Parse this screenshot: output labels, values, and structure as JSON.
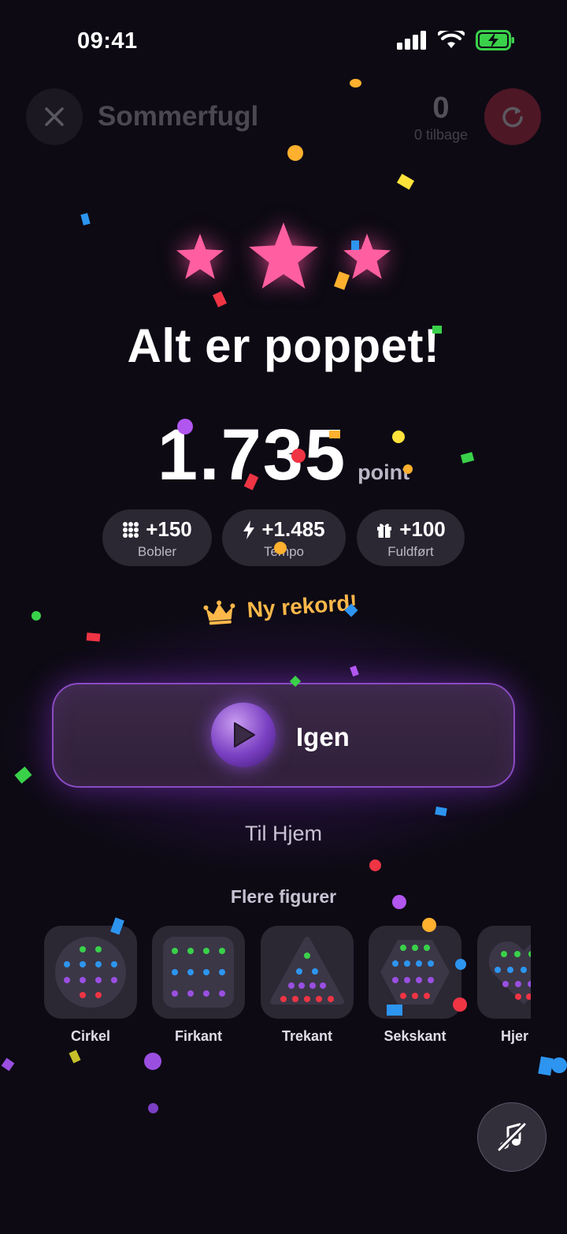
{
  "status_bar": {
    "time": "09:41"
  },
  "header": {
    "level_title": "Sommerfugl",
    "moves_count": "0",
    "moves_label": "0 tilbage"
  },
  "result": {
    "stars_earned": 3,
    "title": "Alt er poppet!",
    "score": "1.735",
    "score_unit": "point"
  },
  "bonuses": [
    {
      "value": "+150",
      "label": "Bobler",
      "icon": "grid-dots-icon"
    },
    {
      "value": "+1.485",
      "label": "Tempo",
      "icon": "lightning-icon"
    },
    {
      "value": "+100",
      "label": "Fuldført",
      "icon": "gift-icon"
    }
  ],
  "record": {
    "label": "Ny rekord!",
    "icon": "crown-icon"
  },
  "actions": {
    "play_again": "Igen",
    "home": "Til Hjem"
  },
  "more_figures": {
    "label": "Flere figurer",
    "items": [
      {
        "label": "Cirkel",
        "shape": "circle"
      },
      {
        "label": "Firkant",
        "shape": "square"
      },
      {
        "label": "Trekant",
        "shape": "triangle"
      },
      {
        "label": "Sekskant",
        "shape": "hexagon"
      },
      {
        "label": "Hjer",
        "shape": "heart"
      }
    ]
  },
  "sound": {
    "icon": "music-muted-icon"
  },
  "colors": {
    "background": "#0d0a14",
    "star": "#ff5fa0",
    "record": "#ffb84a",
    "accent_purple": "#8a4bc2",
    "restart": "#d8344a"
  }
}
